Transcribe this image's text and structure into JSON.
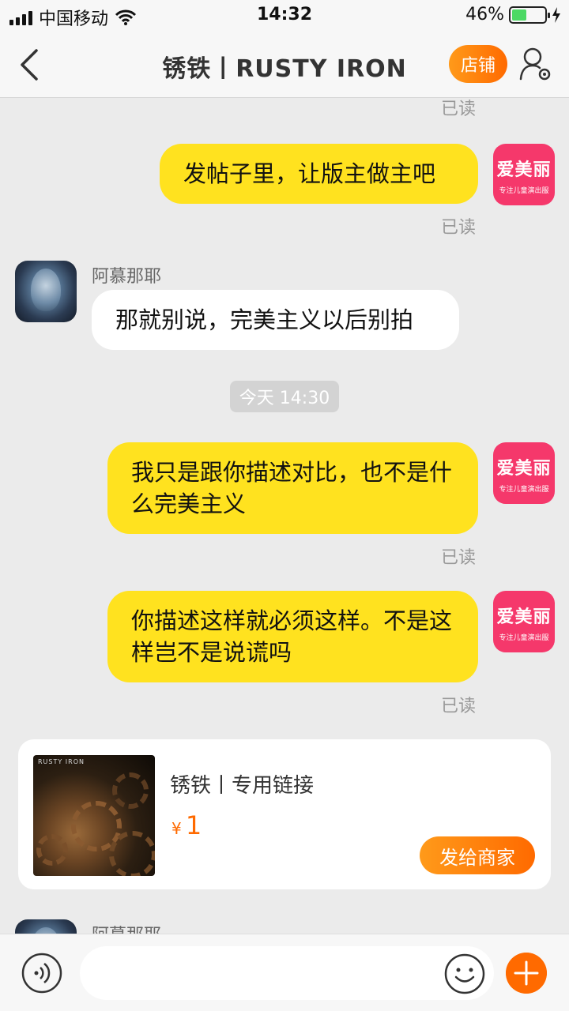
{
  "status_bar": {
    "carrier": "中国移动",
    "time": "14:32",
    "battery_percent": "46%",
    "battery_level": 0.46
  },
  "nav": {
    "title": "锈铁丨RUSTY IRON",
    "shop_label": "店铺",
    "icons": {
      "back": "chevron-left-icon",
      "user_settings": "user-settings-icon"
    }
  },
  "shop_avatar": {
    "text": "爱美丽",
    "subtext": "专注儿童演出服"
  },
  "chat": {
    "read_label": "已读",
    "peer_name": "阿慕那耶",
    "messages": [
      {
        "from": "me",
        "text": "发帖子里，让版主做主吧"
      },
      {
        "from": "peer",
        "text": "那就别说，完美主义以后别拍"
      },
      {
        "from": "me",
        "text": "我只是跟你描述对比，也不是什么完美主义"
      },
      {
        "from": "me",
        "text": "你描述这样就必须这样。不是这样岂不是说谎吗"
      }
    ],
    "time_divider": "今天 14:30"
  },
  "product_card": {
    "image_brand": "RUSTY IRON",
    "title": "锈铁丨专用链接",
    "currency": "¥",
    "price": "1",
    "send_label": "发给商家"
  },
  "input_bar": {
    "placeholder": "",
    "icons": {
      "voice": "voice-icon",
      "emoji": "emoji-icon",
      "plus": "plus-icon"
    }
  },
  "colors": {
    "accent": "#ff6a00",
    "bubble_me": "#ffe21f",
    "shop_avatar": "#f5386b",
    "background": "#ebebeb"
  }
}
